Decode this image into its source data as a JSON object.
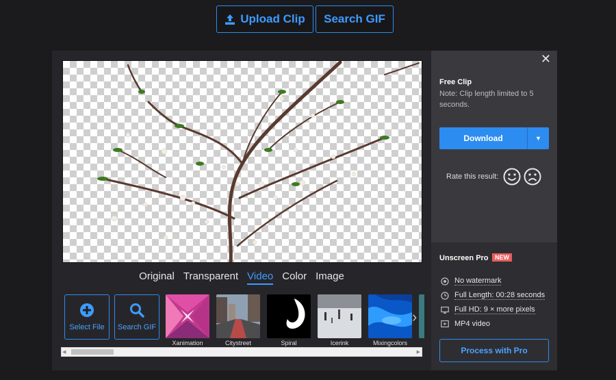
{
  "header": {
    "upload_label": "Upload Clip",
    "search_gif_label": "Search GIF"
  },
  "editor": {
    "tabs": [
      {
        "label": "Original",
        "active": false
      },
      {
        "label": "Transparent",
        "active": false
      },
      {
        "label": "Video",
        "active": true
      },
      {
        "label": "Color",
        "active": false
      },
      {
        "label": "Image",
        "active": false
      }
    ],
    "actions": {
      "select_file_label": "Select File",
      "search_gif_label": "Search GIF"
    },
    "backgrounds": [
      {
        "label": "Xanimation"
      },
      {
        "label": "Citystreet"
      },
      {
        "label": "Spiral"
      },
      {
        "label": "Icerink"
      },
      {
        "label": "Mixingcolors"
      }
    ]
  },
  "sidebar": {
    "free_title": "Free Clip",
    "free_note": "Note: Clip length limited to 5 seconds.",
    "download_label": "Download",
    "rate_label": "Rate this result:",
    "pro_title": "Unscreen Pro",
    "pro_badge": "NEW",
    "features": [
      {
        "label": "No watermark",
        "icon": "no-watermark-icon"
      },
      {
        "label": "Full Length: 00:28 seconds",
        "icon": "clock-icon"
      },
      {
        "label": "Full HD: 9 × more pixels",
        "icon": "monitor-icon"
      },
      {
        "label": "MP4 video",
        "icon": "video-file-icon"
      }
    ],
    "pro_button_label": "Process with Pro"
  },
  "colors": {
    "accent": "#2d8cf0",
    "badge": "#e85d5d",
    "background": "#1b1b1e"
  }
}
